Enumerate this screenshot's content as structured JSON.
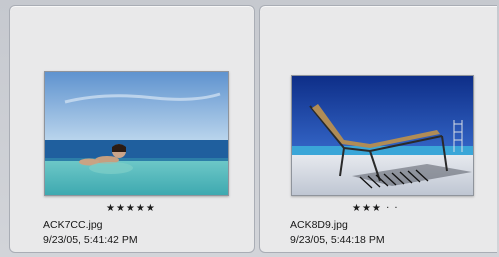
{
  "photos": [
    {
      "filename": "ACK7CC.jpg",
      "date": "9/23/05, 5:41:42 PM",
      "rating": 5,
      "rating_display": "★★★★★"
    },
    {
      "filename": "ACK8D9.jpg",
      "date": "9/23/05, 5:44:18 PM",
      "rating": 3,
      "rating_display": "★★★ · ·"
    }
  ]
}
